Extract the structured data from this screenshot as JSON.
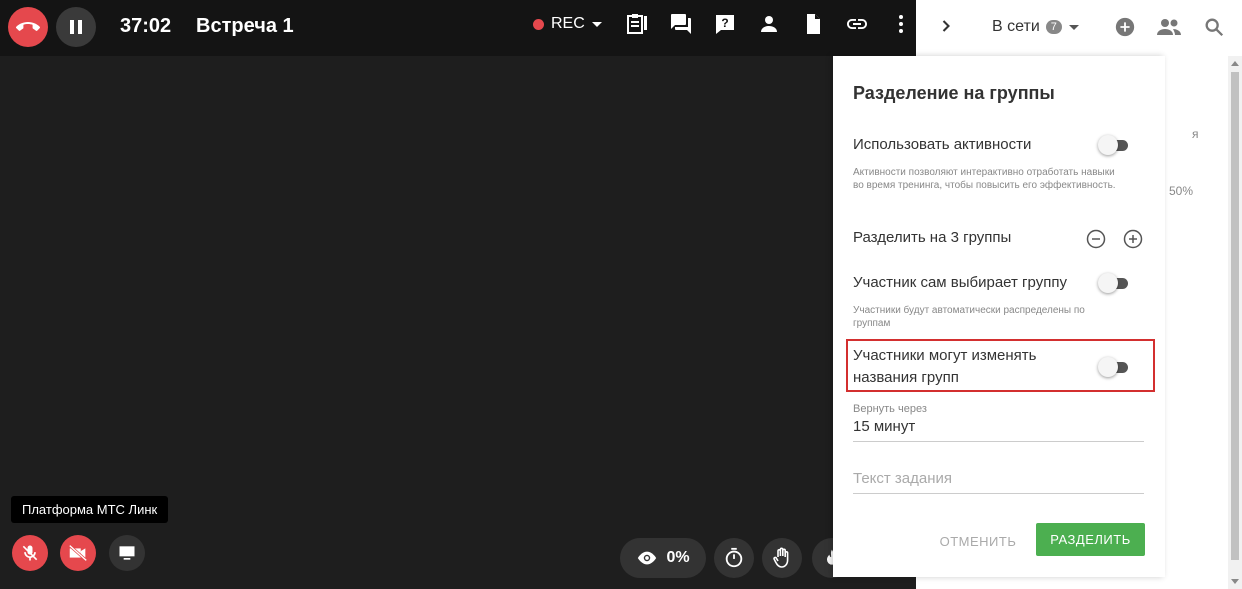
{
  "topbar": {
    "timer": "37:02",
    "meeting_title": "Встреча 1",
    "rec_label": "REC",
    "colors": {
      "end_call": "#e5484d",
      "rec_dot": "#e5484d"
    },
    "icons": [
      "end-call-icon",
      "pause-icon",
      "rec-dropdown-icon",
      "notes-icon",
      "chat-icon",
      "question-icon",
      "participant-icon",
      "document-icon",
      "link-icon",
      "more-vertical-icon"
    ]
  },
  "stage": {
    "tooltip": "Платформа МТС Линк",
    "views_percent": "0%",
    "icons": [
      "mic-off-icon",
      "camera-off-icon",
      "screen-share-icon",
      "eye-icon",
      "stopwatch-icon",
      "raise-hand-icon",
      "fire-icon"
    ]
  },
  "sidebar": {
    "online_label": "В сети",
    "online_count": "7",
    "partial_text_1": "я",
    "partial_text_2": "50%",
    "icons": [
      "chevron-right-icon",
      "add-circle-icon",
      "people-icon",
      "search-icon"
    ]
  },
  "dialog": {
    "title": "Разделение на группы",
    "use_activities": {
      "label": "Использовать активности",
      "hint": "Активности позволяют интерактивно отработать навыки во время тренинга, чтобы повысить его эффективность.",
      "enabled": false
    },
    "groups_count_label": "Разделить на 3 группы",
    "self_select": {
      "label": "Участник сам выбирает группу",
      "hint": "Участники будут автоматически распределены по группам",
      "enabled": false
    },
    "rename_groups": {
      "label_line1": "Участники могут изменять",
      "label_line2": "названия групп",
      "enabled": false
    },
    "return_after": {
      "label": "Вернуть через",
      "value": "15 минут"
    },
    "task_text": {
      "placeholder": "Текст задания"
    },
    "cancel_label": "ОТМЕНИТЬ",
    "split_label": "РАЗДЕЛИТЬ",
    "colors": {
      "split_button": "#4caf50",
      "highlight": "#d32f2f"
    }
  }
}
